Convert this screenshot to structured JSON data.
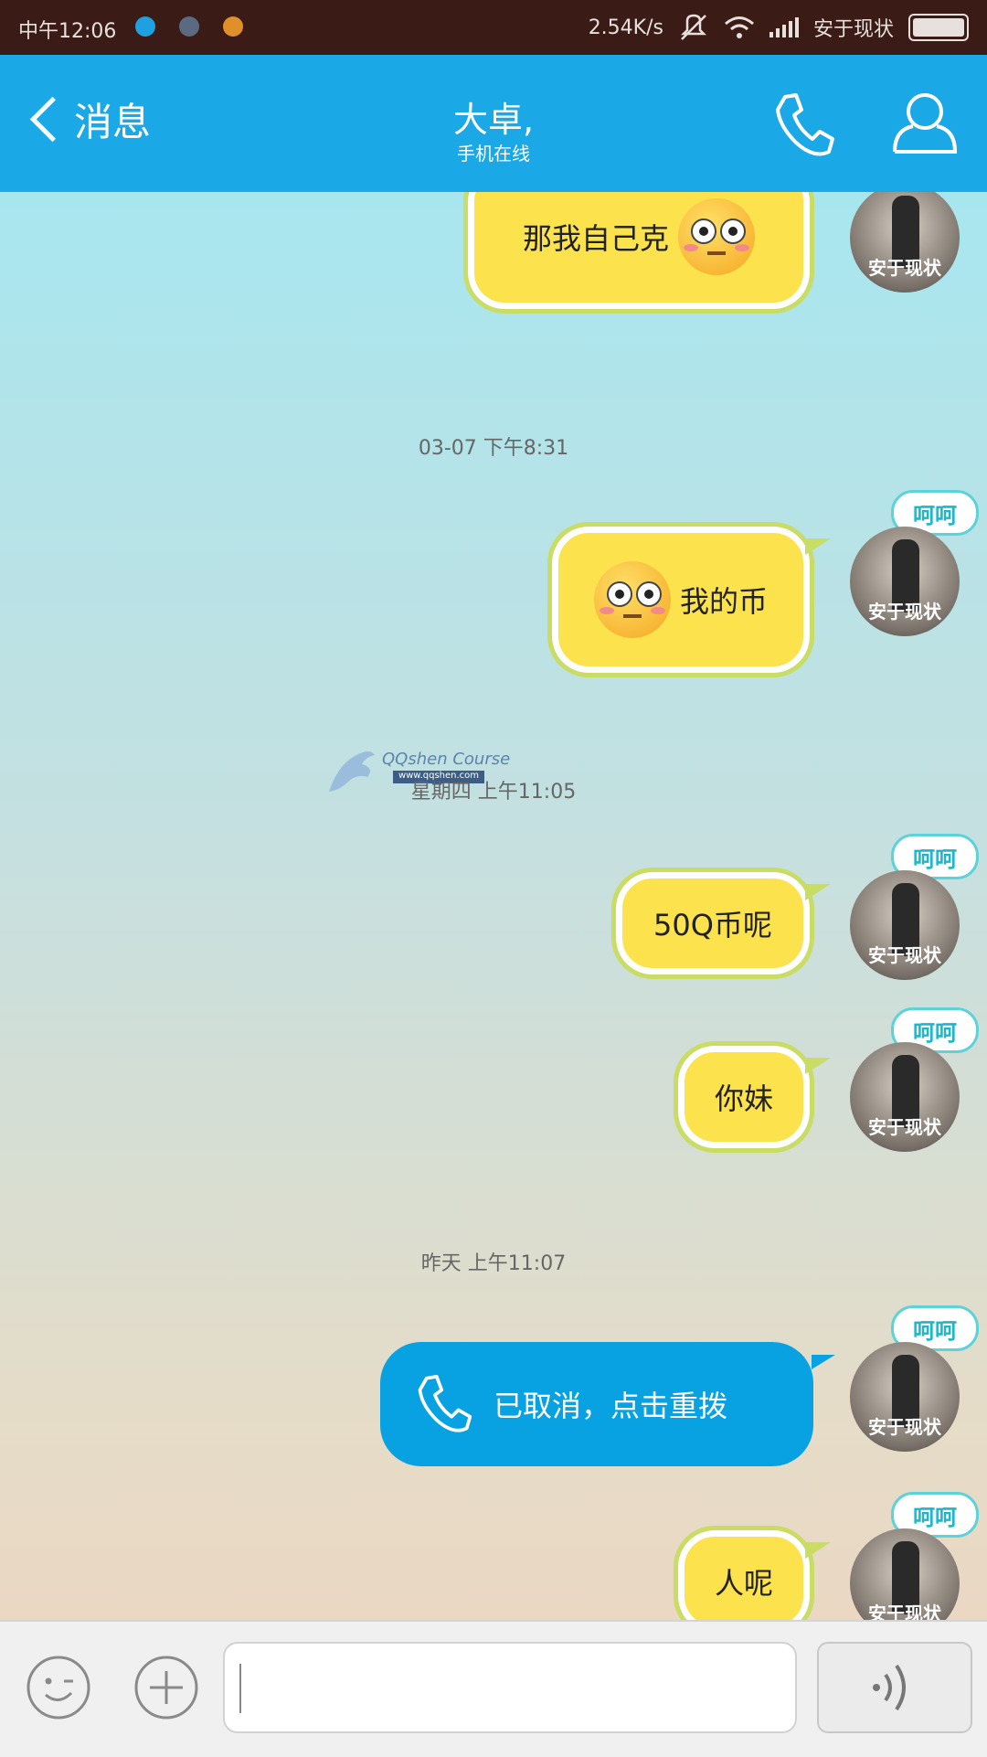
{
  "status_bar": {
    "time": "中午12:06",
    "speed": "2.54K/s",
    "carrier": "安于现状"
  },
  "header": {
    "back_label": "消息",
    "contact_name": "大卓,",
    "contact_status": "手机在线"
  },
  "messages": [
    {
      "type": "text",
      "text": "那我自己克",
      "emoji": "flushed-face"
    },
    {
      "type": "timestamp",
      "text": "03-07 下午8:31"
    },
    {
      "type": "text",
      "text": "我的币",
      "emoji": "flushed-face"
    },
    {
      "type": "timestamp",
      "text": "星期四 上午11:05"
    },
    {
      "type": "text",
      "text": "50Q币呢"
    },
    {
      "type": "text",
      "text": "你妹"
    },
    {
      "type": "timestamp",
      "text": "昨天 上午11:07"
    },
    {
      "type": "call",
      "text": "已取消，点击重拨"
    },
    {
      "type": "text",
      "text": "人呢"
    }
  ],
  "avatar": {
    "label": "安于现状",
    "cloud_text": "呵呵"
  },
  "watermark": {
    "title": "QQshen Course",
    "url": "www.qqshen.com"
  },
  "colors": {
    "header": "#1aa8e6",
    "bubble": "#fce24d",
    "call_bubble": "#08a2e3",
    "status_bar": "#3a1b16"
  }
}
